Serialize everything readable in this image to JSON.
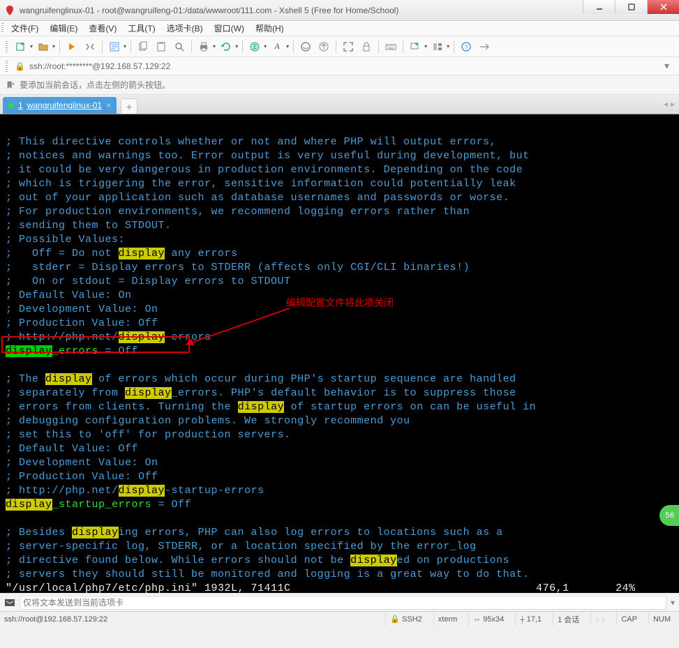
{
  "window": {
    "title": "wangruifenglinux-01 - root@wangruifeng-01:/data/wwwroot/111.com - Xshell 5 (Free for Home/School)"
  },
  "menu": {
    "file": "文件(F)",
    "edit": "编辑(E)",
    "view": "查看(V)",
    "tools": "工具(T)",
    "tabs": "选项卡(B)",
    "window": "窗口(W)",
    "help": "帮助(H)"
  },
  "address": {
    "text": "ssh://root:********@192.168.57.129:22"
  },
  "hint": {
    "text": "要添加当前会话，点击左侧的箭头按钮。"
  },
  "tab": {
    "index": "1",
    "label": "wangruifenglinux-01"
  },
  "terminal": {
    "lines": [
      "",
      "; This directive controls whether or not and where PHP will output errors,",
      "; notices and warnings too. Error output is very useful during development, but",
      "; it could be very dangerous in production environments. Depending on the code",
      "; which is triggering the error, sensitive information could potentially leak",
      "; out of your application such as database usernames and passwords or worse.",
      "; For production environments, we recommend logging errors rather than",
      "; sending them to STDOUT.",
      "; Possible Values:",
      ";   Off = Do not |display| any errors",
      ";   stderr = Display errors to STDERR (affects only CGI/CLI binaries!)",
      ";   On or stdout = Display errors to STDOUT",
      "; Default Value: On",
      "; Development Value: On",
      "; Production Value: Off",
      "; http://php.net/|display|-errors",
      "~display~^_errors^ = Off",
      "",
      "; The |display| of errors which occur during PHP's startup sequence are handled",
      "; separately from |display|_errors. PHP's default behavior is to suppress those",
      "; errors from clients. Turning the |display| of startup errors on can be useful in",
      "; debugging configuration problems. We strongly recommend you",
      "; set this to 'off' for production servers.",
      "; Default Value: Off",
      "; Development Value: On",
      "; Production Value: Off",
      "; http://php.net/|display|-startup-errors",
      "|display|^_startup_errors^ = Off",
      "",
      "; Besides |display|ing errors, PHP can also log errors to locations such as a",
      "; server-specific log, STDERR, or a location specified by the error_log",
      "; directive found below. While errors should not be |display|ed on productions",
      "; servers they should still be monitored and logging is a great way to do that."
    ],
    "status_left": "\"/usr/local/php7/etc/php.ini\" 1932L, 71411C",
    "status_mid": "476,1",
    "status_right": "24%"
  },
  "annotation": {
    "text": "编辑配置文件将此项关闭"
  },
  "input": {
    "placeholder": "仅将文本发送到当前选项卡"
  },
  "status": {
    "conn": "ssh://root@192.168.57.129:22",
    "proto": "SSH2",
    "term": "xterm",
    "size": "95x34",
    "cursor": "17,1",
    "sess": "1 会话",
    "cap": "CAP",
    "num": "NUM"
  },
  "badge": "56"
}
